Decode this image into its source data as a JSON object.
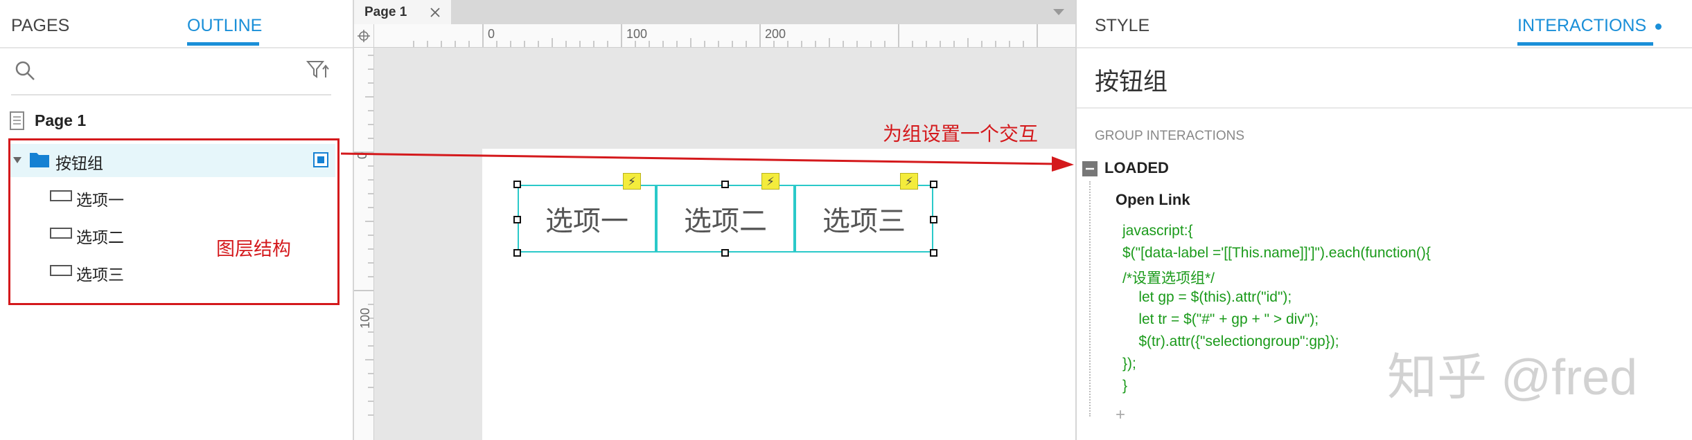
{
  "left_panel": {
    "tabs": {
      "pages": "PAGES",
      "outline": "OUTLINE"
    },
    "tree": {
      "page": "Page 1",
      "group": "按钮组",
      "children": [
        "选项一",
        "选项二",
        "选项三"
      ]
    },
    "annotation": "图层结构"
  },
  "canvas": {
    "tab_label": "Page 1",
    "ruler_top": [
      "0",
      "100",
      "200"
    ],
    "ruler_left": [
      "0",
      "100"
    ],
    "buttons": [
      "选项一",
      "选项二",
      "选项三"
    ],
    "annotation": "为组设置一个交互"
  },
  "right_panel": {
    "tabs": {
      "style": "STYLE",
      "interactions": "INTERACTIONS"
    },
    "title": "按钮组",
    "section_label": "GROUP INTERACTIONS",
    "event": "LOADED",
    "action": "Open Link",
    "code_lines": [
      "javascript:{",
      "$(\"[data-label ='[[This.name]]']\").each(function(){",
      "/*设置选项组*/",
      "    let gp = $(this).attr(\"id\");",
      "    let tr = $(\"#\" + gp + \" > div\");",
      "    $(tr).attr({\"selectiongroup\":gp});",
      "});",
      "}"
    ],
    "add_symbol": "+"
  },
  "watermark": "知乎 @fred",
  "colors": {
    "accent": "#1a8fd8",
    "annotation_red": "#d4191c",
    "code_green": "#1a9a1a",
    "selection_cyan": "#2ac9c9",
    "interaction_badge": "#f4ec3c"
  },
  "icons": {
    "search": "search-icon",
    "filter": "filter-icon",
    "page": "page-icon",
    "folder": "folder-icon",
    "widget": "rectangle-widget-icon",
    "close": "close-icon",
    "interaction": "lightning-icon",
    "collapse": "minus-box-icon"
  }
}
